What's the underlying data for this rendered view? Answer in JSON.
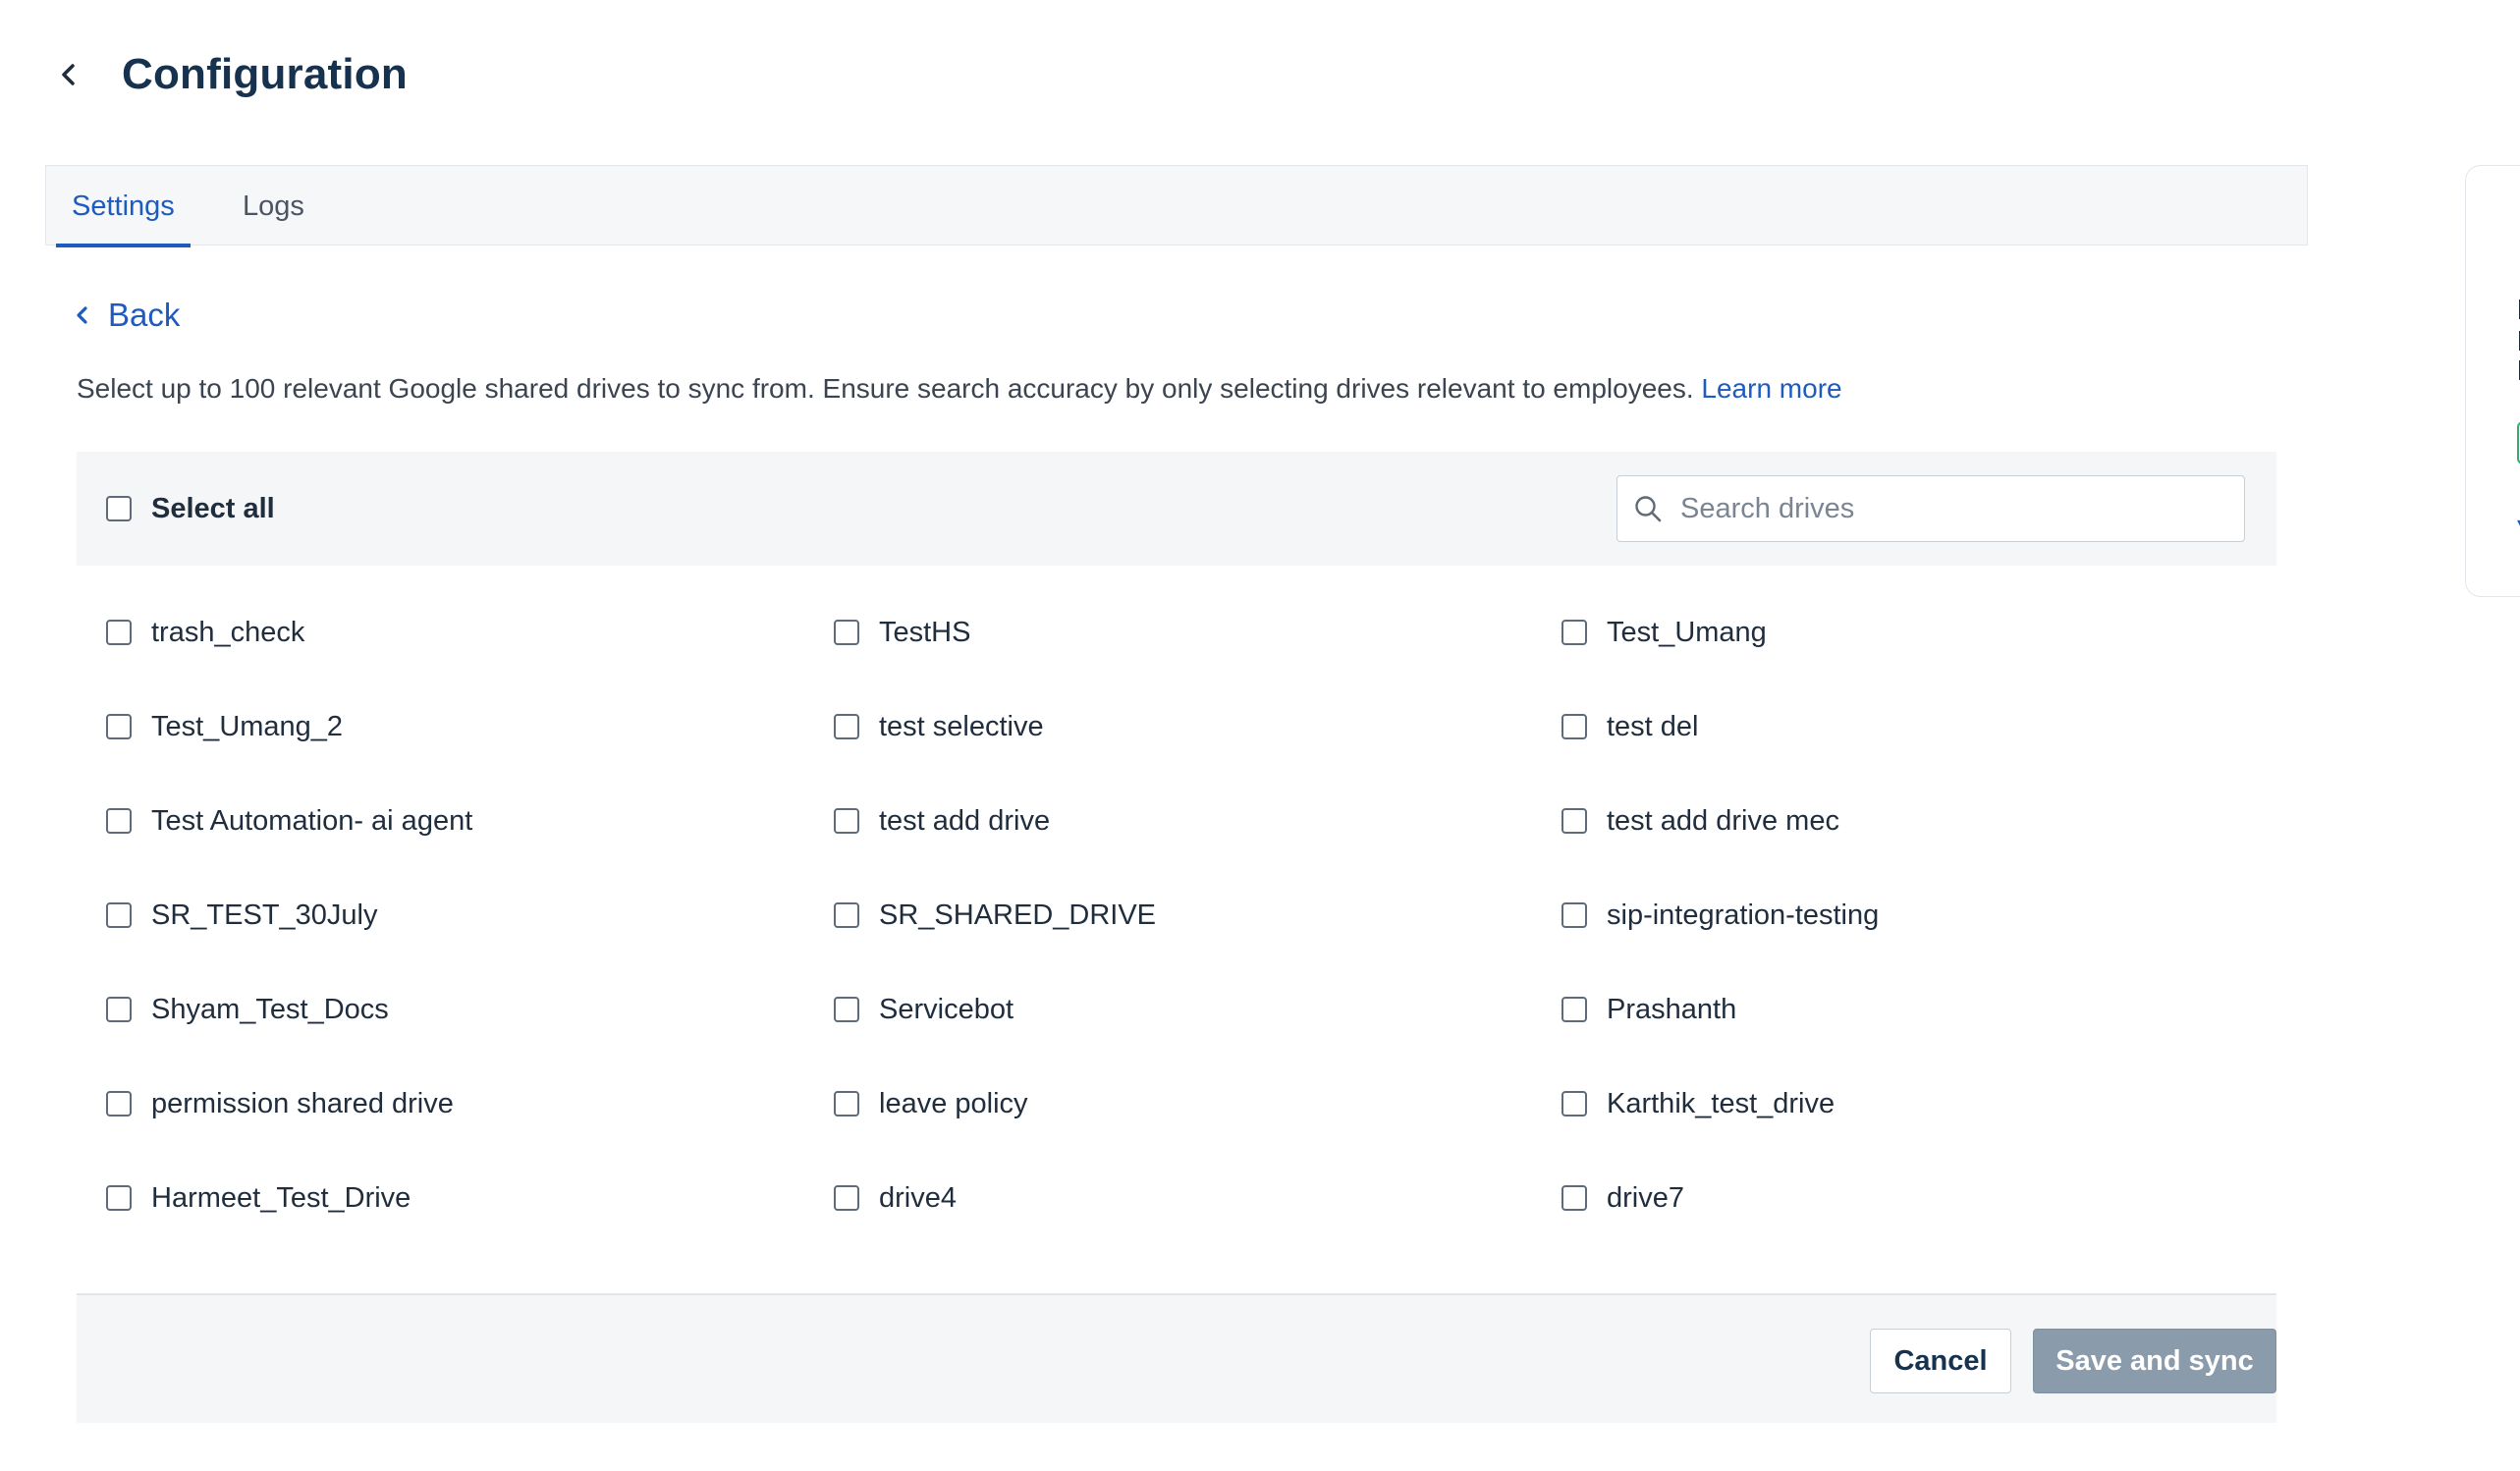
{
  "header": {
    "title": "Configuration",
    "back_icon": "chevron-left-icon"
  },
  "tabs": [
    {
      "label": "Settings",
      "active": true
    },
    {
      "label": "Logs",
      "active": false
    }
  ],
  "back_link": {
    "label": "Back",
    "icon": "chevron-left-icon"
  },
  "description": {
    "text": "Select up to 100 relevant Google shared drives to sync from. Ensure search accuracy by only selecting drives relevant to employees. ",
    "link_label": "Learn more"
  },
  "select_all": {
    "label": "Select all",
    "checked": false
  },
  "search": {
    "placeholder": "Search drives",
    "value": "",
    "icon": "search-icon"
  },
  "drives": [
    {
      "label": "trash_check",
      "checked": false
    },
    {
      "label": "TestHS",
      "checked": false
    },
    {
      "label": "Test_Umang",
      "checked": false
    },
    {
      "label": "Test_Umang_2",
      "checked": false
    },
    {
      "label": "test selective",
      "checked": false
    },
    {
      "label": "test del",
      "checked": false
    },
    {
      "label": "Test Automation- ai agent",
      "checked": false
    },
    {
      "label": "test add drive",
      "checked": false
    },
    {
      "label": "test add drive mec",
      "checked": false
    },
    {
      "label": "SR_TEST_30July",
      "checked": false
    },
    {
      "label": "SR_SHARED_DRIVE",
      "checked": false
    },
    {
      "label": "sip-integration-testing",
      "checked": false
    },
    {
      "label": "Shyam_Test_Docs",
      "checked": false
    },
    {
      "label": "Servicebot",
      "checked": false
    },
    {
      "label": "Prashanth",
      "checked": false
    },
    {
      "label": "permission shared drive",
      "checked": false
    },
    {
      "label": "leave policy",
      "checked": false
    },
    {
      "label": "Karthik_test_drive",
      "checked": false
    },
    {
      "label": "Harmeet_Test_Drive",
      "checked": false
    },
    {
      "label": "drive4",
      "checked": false
    },
    {
      "label": "drive7",
      "checked": false
    }
  ],
  "footer": {
    "cancel_label": "Cancel",
    "save_label": "Save and sync",
    "save_enabled": false
  },
  "colors": {
    "accent": "#1d5bbf",
    "title": "#16324f",
    "disabled_button": "#8a9bac"
  }
}
